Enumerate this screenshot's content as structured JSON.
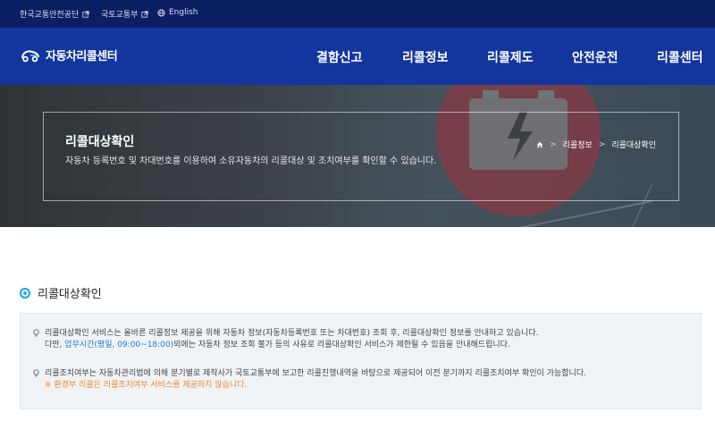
{
  "util_bar": {
    "links": [
      {
        "label": "한국교통안전공단",
        "icon": "external-link-icon"
      },
      {
        "label": "국토교통부",
        "icon": "external-link-icon"
      },
      {
        "label": "English",
        "icon": "globe-icon"
      }
    ]
  },
  "header": {
    "logo_text": "자동차리콜센터",
    "nav": [
      "결함신고",
      "리콜정보",
      "리콜제도",
      "안전운전",
      "리콜센터"
    ]
  },
  "banner": {
    "title": "리콜대상확인",
    "description": "자동차 등록번호 및 차대번호를 이용하여 소유자동차의 리콜대상 및 조치여부를 확인할 수 있습니다.",
    "breadcrumb": [
      "리콜정보",
      "리콜대상확인"
    ]
  },
  "main": {
    "section_title": "리콜대상확인",
    "info": {
      "p1_line1": "리콜대상확인 서비스는 올바른 리콜정보 제공을 위해 자동차 정보(자동차등록번호 또는 차대번호) 조회 후, 리콜대상확인 정보를 안내하고 있습니다.",
      "p1_line2_prefix": "다만, ",
      "p1_line2_link": "업무시간(평일, 09:00~18:00)",
      "p1_line2_suffix": "외에는 자동차 정보 조회 불가 등의 사유로 리콜대상확인 서비스가 제한될 수 있음을 안내해드립니다.",
      "p2_line1": "리콜조치여부는 자동차관리법에 의해 분기별로 제작사가 국토교통부에 보고한 리콜진행내역을 바탕으로 제공되어 이전 분기까지 리콜조치여부 확인이 가능합니다.",
      "p2_note": "※ 환경부 리콜은 리콜조치여부 서비스를 제공하지 않습니다."
    }
  },
  "colors": {
    "util_bar_bg": "#0d1f63",
    "header_bg": "#13359e",
    "link_blue": "#1f7bd6",
    "note_orange": "#f0872c",
    "bullet_cyan": "#29a8e0"
  }
}
